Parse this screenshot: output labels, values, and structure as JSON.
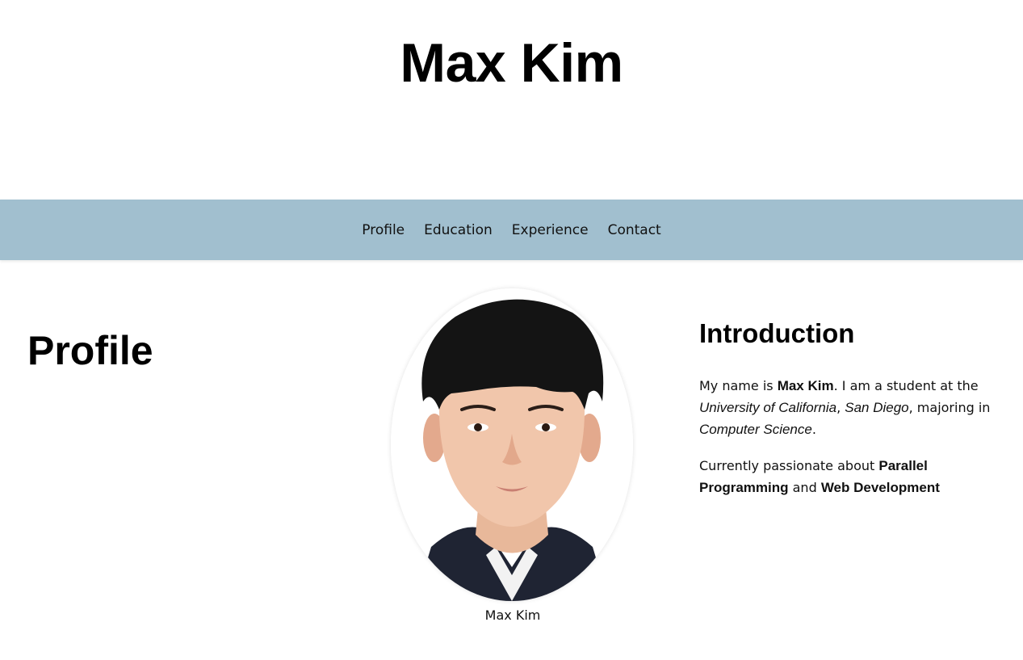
{
  "header": {
    "title": "Max Kim"
  },
  "nav": {
    "items": [
      "Profile",
      "Education",
      "Experience",
      "Contact"
    ]
  },
  "profile": {
    "section_title": "Profile",
    "photo_caption": "Max Kim",
    "intro": {
      "title": "Introduction",
      "p1": {
        "t1": "My name is ",
        "name": "Max Kim",
        "t2": ". I am a student at the ",
        "university": "University of California",
        "t3": ", ",
        "campus": "San Diego",
        "t4": ", majoring in ",
        "major": "Computer Science",
        "t5": "."
      },
      "p2": {
        "t1": "Currently passionate about ",
        "interest1": "Parallel Programming",
        "t2": " and ",
        "interest2": "Web Development"
      }
    }
  },
  "colors": {
    "nav_background": "#a1bfcf",
    "text": "#000000",
    "background": "#ffffff"
  }
}
